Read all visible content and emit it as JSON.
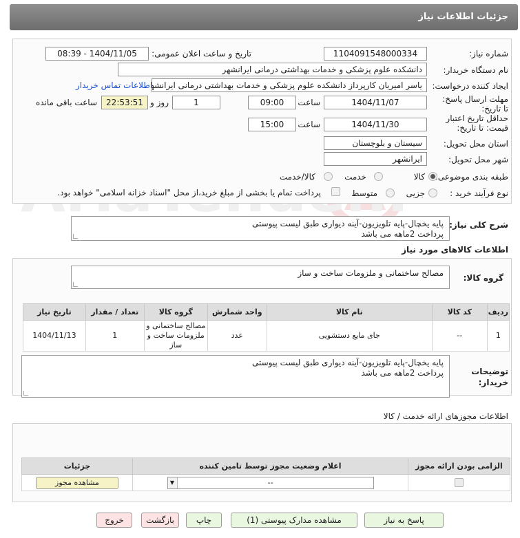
{
  "header": {
    "title": "جزئیات اطلاعات نیاز"
  },
  "form": {
    "need_number_label": "شماره نیاز:",
    "need_number": "1104091548000334",
    "announce_label": "تاریخ و ساعت اعلان عمومی:",
    "announce_value": "1404/11/05 - 08:39",
    "buyer_org_label": "نام دستگاه خریدار:",
    "buyer_org": "دانشکده علوم پزشکی و خدمات بهداشتی درمانی ایرانشهر",
    "creator_label": "ایجاد کننده درخواست:",
    "creator": "یاسر امیریان کارپرداز دانشکده علوم پزشکی و خدمات بهداشتی درمانی ایرانشهر",
    "contact_link": "اطلاعات تماس خریدار",
    "deadline_label": "مهلت ارسال پاسخ: تا تاریخ:",
    "deadline_date": "1404/11/07",
    "time_label": "ساعت",
    "deadline_time": "09:00",
    "days_value": "1",
    "days_label": "روز و",
    "remaining_time": "22:53:51",
    "remaining_label": "ساعت باقی مانده",
    "validity_label": "حداقل تاریخ اعتبار قیمت: تا تاریخ:",
    "validity_date": "1404/11/30",
    "validity_time": "15:00",
    "province_label": "استان محل تحویل:",
    "province": "سیستان و بلوچستان",
    "city_label": "شهر محل تحویل:",
    "city": "ایرانشهر",
    "category_label": "طبقه بندی موضوعی:",
    "category_options": [
      "کالا",
      "خدمت",
      "کالا/خدمت"
    ],
    "process_label": "نوع فرآیند خرید :",
    "process_options": [
      "جزیی",
      "متوسط"
    ],
    "payment_note": "پرداخت تمام یا بخشی از مبلغ خرید،از محل \"اسناد خزانه اسلامی\" خواهد بود."
  },
  "description": {
    "label": "شرح کلی نیاز:",
    "text": "پایه یخچال-پایه تلویزیون-آینه دیواری طبق لیست پیوستی\nپرداخت 2ماهه می باشد"
  },
  "goods": {
    "section_title": "اطلاعات کالاهای مورد نیاز",
    "group_label": "گروه کالا:",
    "group_value": "مصالح ساختمانی و ملزومات ساخت و ساز",
    "columns": [
      "ردیف",
      "کد کالا",
      "نام کالا",
      "واحد شمارش",
      "گروه کالا",
      "تعداد / مقدار",
      "تاریخ نیاز"
    ],
    "rows": [
      {
        "row": "1",
        "code": "--",
        "name": "جای مایع دستشویی",
        "unit": "عدد",
        "group": "مصالح ساختمانی و ملزومات ساخت و ساز",
        "qty": "1",
        "date": "1404/11/13"
      }
    ]
  },
  "buyer_notes": {
    "label": "توضیحات خریدار:",
    "text": "پایه یخچال-پایه تلویزیون-آینه دیواری طبق لیست پیوستی\nپرداخت 2ماهه می باشد"
  },
  "licenses": {
    "section_title": "اطلاعات مجوزهای ارائه خدمت / کالا",
    "columns": [
      "الزامی بودن ارائه مجوز",
      "اعلام وضعیت مجوز توسط تامین کننده",
      "جزئیات"
    ],
    "select_value": "--",
    "view_button": "مشاهده مجوز"
  },
  "buttons": {
    "reply": "پاسخ به نیاز",
    "attachments": "مشاهده مدارک پیوستی (1)",
    "print": "چاپ",
    "back": "بازگشت",
    "exit": "خروج"
  },
  "colors": {
    "header": "#7d7d7d",
    "link": "#1a4fd0",
    "highlight": "#f6f3c7",
    "green_button": "#e9f7e1",
    "red_button": "#fde3e3"
  }
}
